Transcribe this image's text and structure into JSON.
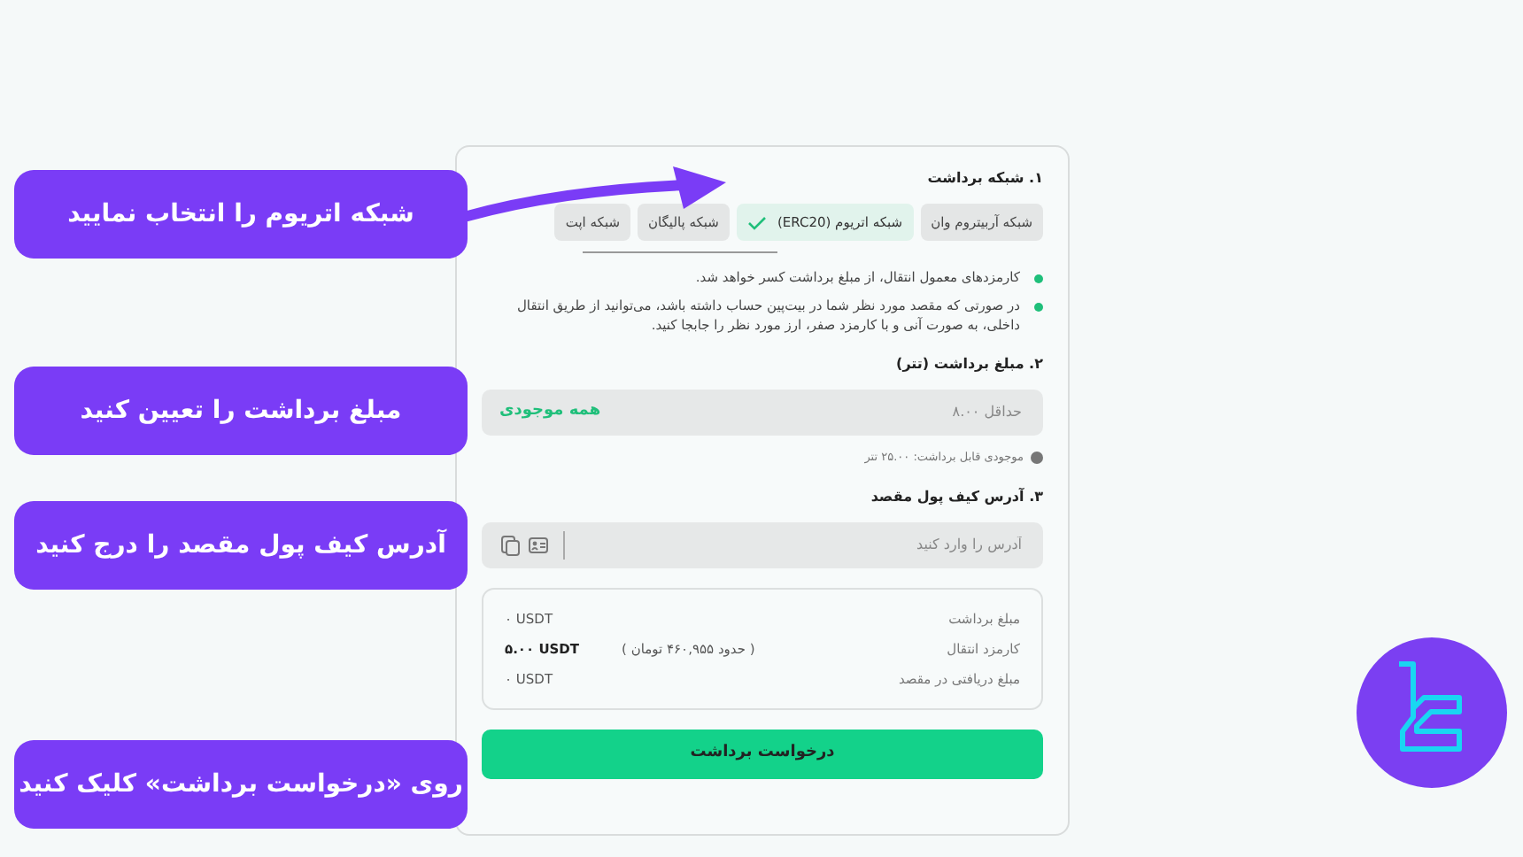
{
  "callouts": [
    {
      "text": "شبکه اتریوم را انتخاب نمایید"
    },
    {
      "text": "مبلغ برداشت را تعیین کنید"
    },
    {
      "text": "آدرس کیف پول مقصد را درج کنید"
    },
    {
      "text": "روی «درخواست برداشت» کلیک کنید"
    }
  ],
  "network": {
    "title": "۱. شبکه برداشت",
    "tabs": [
      {
        "label": "شبکه آربیتروم وان",
        "selected": false
      },
      {
        "label": "شبکه اتریوم (ERC20)",
        "selected": true
      },
      {
        "label": "شبکه پالیگان",
        "selected": false
      },
      {
        "label": "شبکه اپت",
        "selected": false
      }
    ],
    "notes": [
      "کارمزدهای معمول انتقال، از مبلغ برداشت کسر خواهد شد.",
      "در صورتی که مقصد مورد نظر شما در بیت‌پین حساب داشته باشد، می‌توانید از طریق انتقال داخلی، به صورت آنی و با کارمزد صفر، ارز مورد نظر را جابجا کنید."
    ]
  },
  "amount": {
    "title": "۲. مبلغ برداشت (تتر)",
    "placeholder": "حداقل ۸.۰۰",
    "max_link": "همه موجودی",
    "balance": "موجودی قابل برداشت: ۲۵.۰۰ تتر"
  },
  "address": {
    "title": "۳. آدرس کیف پول مقصد",
    "placeholder": "آدرس را وارد کنید"
  },
  "summary": [
    {
      "label": "مبلغ برداشت",
      "value": "۰ USDT"
    },
    {
      "label": "کارمزد انتقال",
      "note": "( حدود ۴۶۰,۹۵۵ تومان )",
      "value": "۵.۰۰ USDT"
    },
    {
      "label": "مبلغ دریافتی در مقصد",
      "value": "۰ USDT"
    }
  ],
  "submit": "درخواست برداشت"
}
